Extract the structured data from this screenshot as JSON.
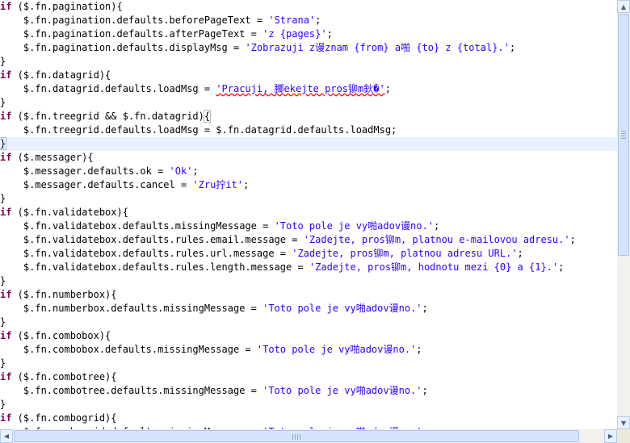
{
  "colors": {
    "keyword": "#7f0055",
    "string": "#2a00ff",
    "text": "#000000",
    "current_line": "#e8f2fe",
    "error_underline": "#ff0000"
  },
  "lines": [
    [
      {
        "t": "if",
        "k": "kw"
      },
      {
        "t": " ($.fn.pagination){"
      }
    ],
    [
      {
        "t": "    $.fn.pagination.defaults.beforePageText = "
      },
      {
        "t": "'Strana'",
        "k": "str"
      },
      {
        "t": ";"
      }
    ],
    [
      {
        "t": "    $.fn.pagination.defaults.afterPageText = "
      },
      {
        "t": "'z {pages}'",
        "k": "str"
      },
      {
        "t": ";"
      }
    ],
    [
      {
        "t": "    $.fn.pagination.defaults.displayMsg = "
      },
      {
        "t": "'Zobrazuji z谩znam {from} a啪 {to} z {total}.'",
        "k": "str"
      },
      {
        "t": ";"
      }
    ],
    [
      {
        "t": "}"
      }
    ],
    [
      {
        "t": "if",
        "k": "kw"
      },
      {
        "t": " ($.fn.datagrid){"
      }
    ],
    [
      {
        "t": "    $.fn.datagrid.defaults.loadMsg = "
      },
      {
        "t": "'Pracuji, 膷ekejte pros铆m鈥�'",
        "k": "str err"
      },
      {
        "t": ";"
      }
    ],
    [
      {
        "t": "}"
      }
    ],
    [
      {
        "t": "if",
        "k": "kw"
      },
      {
        "t": " ($.fn.treegrid && $.fn.datagrid)"
      },
      {
        "t": "{",
        "k": "box"
      }
    ],
    [
      {
        "t": "    $.fn.treegrid.defaults.loadMsg = $.fn.datagrid.defaults.loadMsg;"
      }
    ],
    [
      {
        "t": "}",
        "k": "box"
      }
    ],
    [
      {
        "t": "if",
        "k": "kw"
      },
      {
        "t": " ($.messager){"
      }
    ],
    [
      {
        "t": "    $.messager.defaults.ok = "
      },
      {
        "t": "'Ok'",
        "k": "str"
      },
      {
        "t": ";"
      }
    ],
    [
      {
        "t": "    $.messager.defaults.cancel = "
      },
      {
        "t": "'Zru拧it'",
        "k": "str"
      },
      {
        "t": ";"
      }
    ],
    [
      {
        "t": "}"
      }
    ],
    [
      {
        "t": "if",
        "k": "kw"
      },
      {
        "t": " ($.fn.validatebox){"
      }
    ],
    [
      {
        "t": "    $.fn.validatebox.defaults.missingMessage = "
      },
      {
        "t": "'Toto pole je vy啪adov谩no.'",
        "k": "str"
      },
      {
        "t": ";"
      }
    ],
    [
      {
        "t": "    $.fn.validatebox.defaults.rules.email.message = "
      },
      {
        "t": "'Zadejte, pros铆m, platnou e-mailovou adresu.'",
        "k": "str"
      },
      {
        "t": ";"
      }
    ],
    [
      {
        "t": "    $.fn.validatebox.defaults.rules.url.message = "
      },
      {
        "t": "'Zadejte, pros铆m, platnou adresu URL.'",
        "k": "str"
      },
      {
        "t": ";"
      }
    ],
    [
      {
        "t": "    $.fn.validatebox.defaults.rules.length.message = "
      },
      {
        "t": "'Zadejte, pros铆m, hodnotu mezi {0} a {1}.'",
        "k": "str"
      },
      {
        "t": ";"
      }
    ],
    [
      {
        "t": "}"
      }
    ],
    [
      {
        "t": "if",
        "k": "kw"
      },
      {
        "t": " ($.fn.numberbox){"
      }
    ],
    [
      {
        "t": "    $.fn.numberbox.defaults.missingMessage = "
      },
      {
        "t": "'Toto pole je vy啪adov谩no.'",
        "k": "str"
      },
      {
        "t": ";"
      }
    ],
    [
      {
        "t": "}"
      }
    ],
    [
      {
        "t": "if",
        "k": "kw"
      },
      {
        "t": " ($.fn.combobox){"
      }
    ],
    [
      {
        "t": "    $.fn.combobox.defaults.missingMessage = "
      },
      {
        "t": "'Toto pole je vy啪adov谩no.'",
        "k": "str"
      },
      {
        "t": ";"
      }
    ],
    [
      {
        "t": "}"
      }
    ],
    [
      {
        "t": "if",
        "k": "kw"
      },
      {
        "t": " ($.fn.combotree){"
      }
    ],
    [
      {
        "t": "    $.fn.combotree.defaults.missingMessage = "
      },
      {
        "t": "'Toto pole je vy啪adov谩no.'",
        "k": "str"
      },
      {
        "t": ";"
      }
    ],
    [
      {
        "t": "}"
      }
    ],
    [
      {
        "t": "if",
        "k": "kw"
      },
      {
        "t": " ($.fn.combogrid){"
      }
    ],
    [
      {
        "t": "    $.fn.combogrid.defaults.missingMessage = "
      },
      {
        "t": "'Toto pole je vy啪adov谩no.'",
        "k": "str"
      },
      {
        "t": ";"
      }
    ]
  ],
  "current_line_index": 10,
  "scrollbars": {
    "vertical": {
      "up_icon": "arrow-up-icon",
      "down_icon": "arrow-down-icon",
      "up_glyph": "▲",
      "down_glyph": "▼"
    },
    "horizontal": {
      "left_icon": "arrow-left-icon",
      "right_icon": "arrow-right-icon",
      "left_glyph": "◀",
      "right_glyph": "▶"
    }
  }
}
